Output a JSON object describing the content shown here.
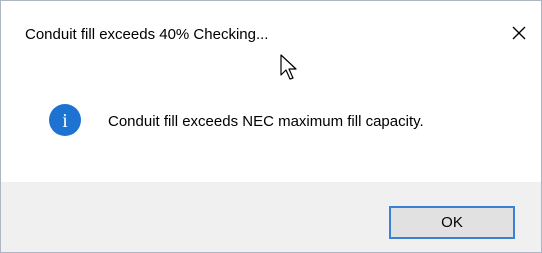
{
  "window": {
    "title": "Conduit fill exceeds 40% Checking...",
    "close_icon": "close-icon"
  },
  "message": {
    "icon": "info-icon",
    "icon_glyph": "i",
    "text": "Conduit fill exceeds NEC maximum fill capacity."
  },
  "buttons": {
    "ok_label": "OK"
  },
  "colors": {
    "info_icon_fill": "#1e73d2",
    "focus_border": "#3b82d6",
    "footer_bg": "#f0f0f0",
    "button_bg": "#e1e1e1"
  }
}
